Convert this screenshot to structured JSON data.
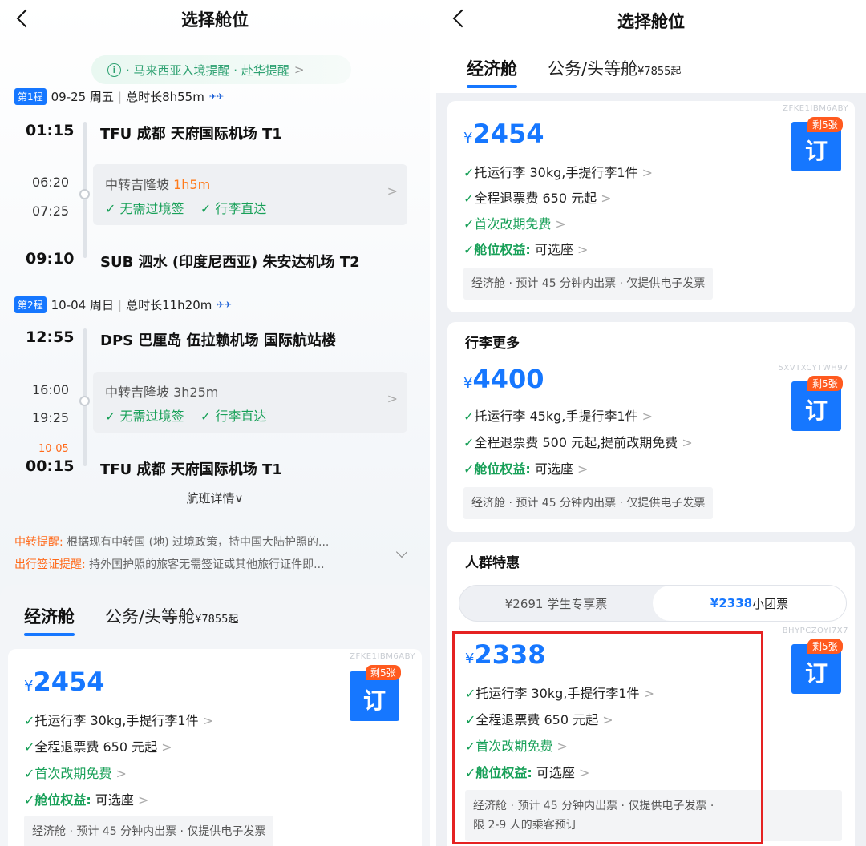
{
  "header": {
    "title": "选择舱位"
  },
  "notice": {
    "text": "· 马来西亚入境提醒  · 赴华提醒"
  },
  "leg1": {
    "tag": "第1程",
    "date": "09-25 周五",
    "duration": "总时长8h55m",
    "dep_time": "01:15",
    "dep_airport": "TFU 成都 天府国际机场 T1",
    "transfer_label": "中转吉隆坡",
    "transfer_dur": "1h5m",
    "arr_tr": "06:20",
    "dep_tr": "07:25",
    "check1": "✓ 无需过境签",
    "check2": "✓ 行李直达",
    "arr_time": "09:10",
    "arr_airport": "SUB 泗水 (印度尼西亚) 朱安达机场 T2"
  },
  "leg2": {
    "tag": "第2程",
    "date": "10-04 周日",
    "duration": "总时长11h20m",
    "dep_time": "12:55",
    "dep_airport": "DPS 巴厘岛 伍拉赖机场 国际航站楼",
    "transfer_label": "中转吉隆坡 3h25m",
    "arr_tr": "16:00",
    "dep_tr": "19:25",
    "check1": "✓ 无需过境签",
    "check2": "✓ 行李直达",
    "next_day": "10-05",
    "arr_time": "00:15",
    "arr_airport": "TFU 成都 天府国际机场 T1"
  },
  "flight_detail": "航班详情∨",
  "reminders": [
    {
      "label": "中转提醒:",
      "text": " 根据现有中转国 (地) 过境政策，持中国大陆护照的..."
    },
    {
      "label": "出行签证提醒:",
      "text": " 持外国护照的旅客无需签证或其他旅行证件即..."
    }
  ],
  "tabs": {
    "economy": "经济舱",
    "business": "公务/头等舱",
    "business_price": "¥7855起"
  },
  "fare1": {
    "code": "ZFKE1IBM6ABY",
    "currency": "¥",
    "price": "2454",
    "remain": "剩5张",
    "book": "订",
    "line1": "托运行李 30kg,手提行李1件",
    "line2": "全程退票费 650 元起",
    "line3": "首次改期免费",
    "line4_label": "舱位权益:",
    "line4_value": " 可选座",
    "note": "经济舱 · 预计 45 分钟内出票 · 仅提供电子发票"
  },
  "fare2": {
    "title": "行李更多",
    "code": "5XVTXCYTWH97",
    "currency": "¥",
    "price": "4400",
    "remain": "剩5张",
    "book": "订",
    "line1": "托运行李 45kg,手提行李1件",
    "line2": "全程退票费 500 元起,提前改期免费",
    "line4_label": "舱位权益:",
    "line4_value": " 可选座",
    "note": "经济舱 · 预计 45 分钟内出票 · 仅提供电子发票"
  },
  "group": {
    "title": "人群特惠",
    "opt1": "¥2691 学生专享票",
    "opt2_price": "¥2338",
    "opt2_label": " 小团票"
  },
  "fare3": {
    "code": "BHYPCZOYI7X7",
    "currency": "¥",
    "price": "2338",
    "remain": "剩5张",
    "book": "订",
    "line1": "托运行李 30kg,手提行李1件",
    "line2": "全程退票费 650 元起",
    "line3": "首次改期免费",
    "line4_label": "舱位权益:",
    "line4_value": " 可选座",
    "note1": "经济舱 · 预计 45 分钟内出票 · 仅提供电子发票 ·",
    "note2": "限 2-9 人的乘客预订"
  },
  "colors": {
    "accent": "#1677ff",
    "green": "#18a058",
    "orange": "#ff6a1a",
    "highlight": "#e52222"
  },
  "icons": [
    "back-arrow-icon",
    "info-icon",
    "chevron-right-icon",
    "chevron-down-icon",
    "airline-logo-icon",
    "check-icon"
  ]
}
